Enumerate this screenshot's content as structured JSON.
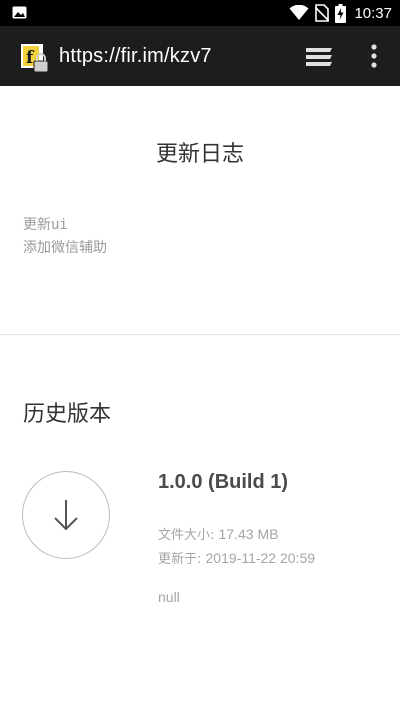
{
  "status_bar": {
    "time": "10:37",
    "icons": [
      "image-notification-icon",
      "wifi-icon",
      "no-sim-icon",
      "battery-charging-icon"
    ]
  },
  "toolbar": {
    "url": "https://fir.im/kzv7",
    "favicon_letter": "f",
    "icons": [
      "site-lock-icon",
      "tabs-stack-icon",
      "more-vert-icon"
    ]
  },
  "changelog": {
    "title": "更新日志",
    "line1": "更新ui",
    "line2": "添加微信辅助"
  },
  "history": {
    "title": "历史版本",
    "release": {
      "version": "1.0.0 (Build 1)",
      "size_label": "文件大小: ",
      "size_value": "17.43 MB",
      "updated_label": "更新于: ",
      "updated_value": "2019-11-22 20:59",
      "note": "null",
      "icon": "download-arrow-icon"
    }
  },
  "colors": {
    "toolbar_bg": "#1d1d1d",
    "status_bg": "#000000",
    "title_text": "#333333",
    "muted_text": "#a5a5a5"
  }
}
